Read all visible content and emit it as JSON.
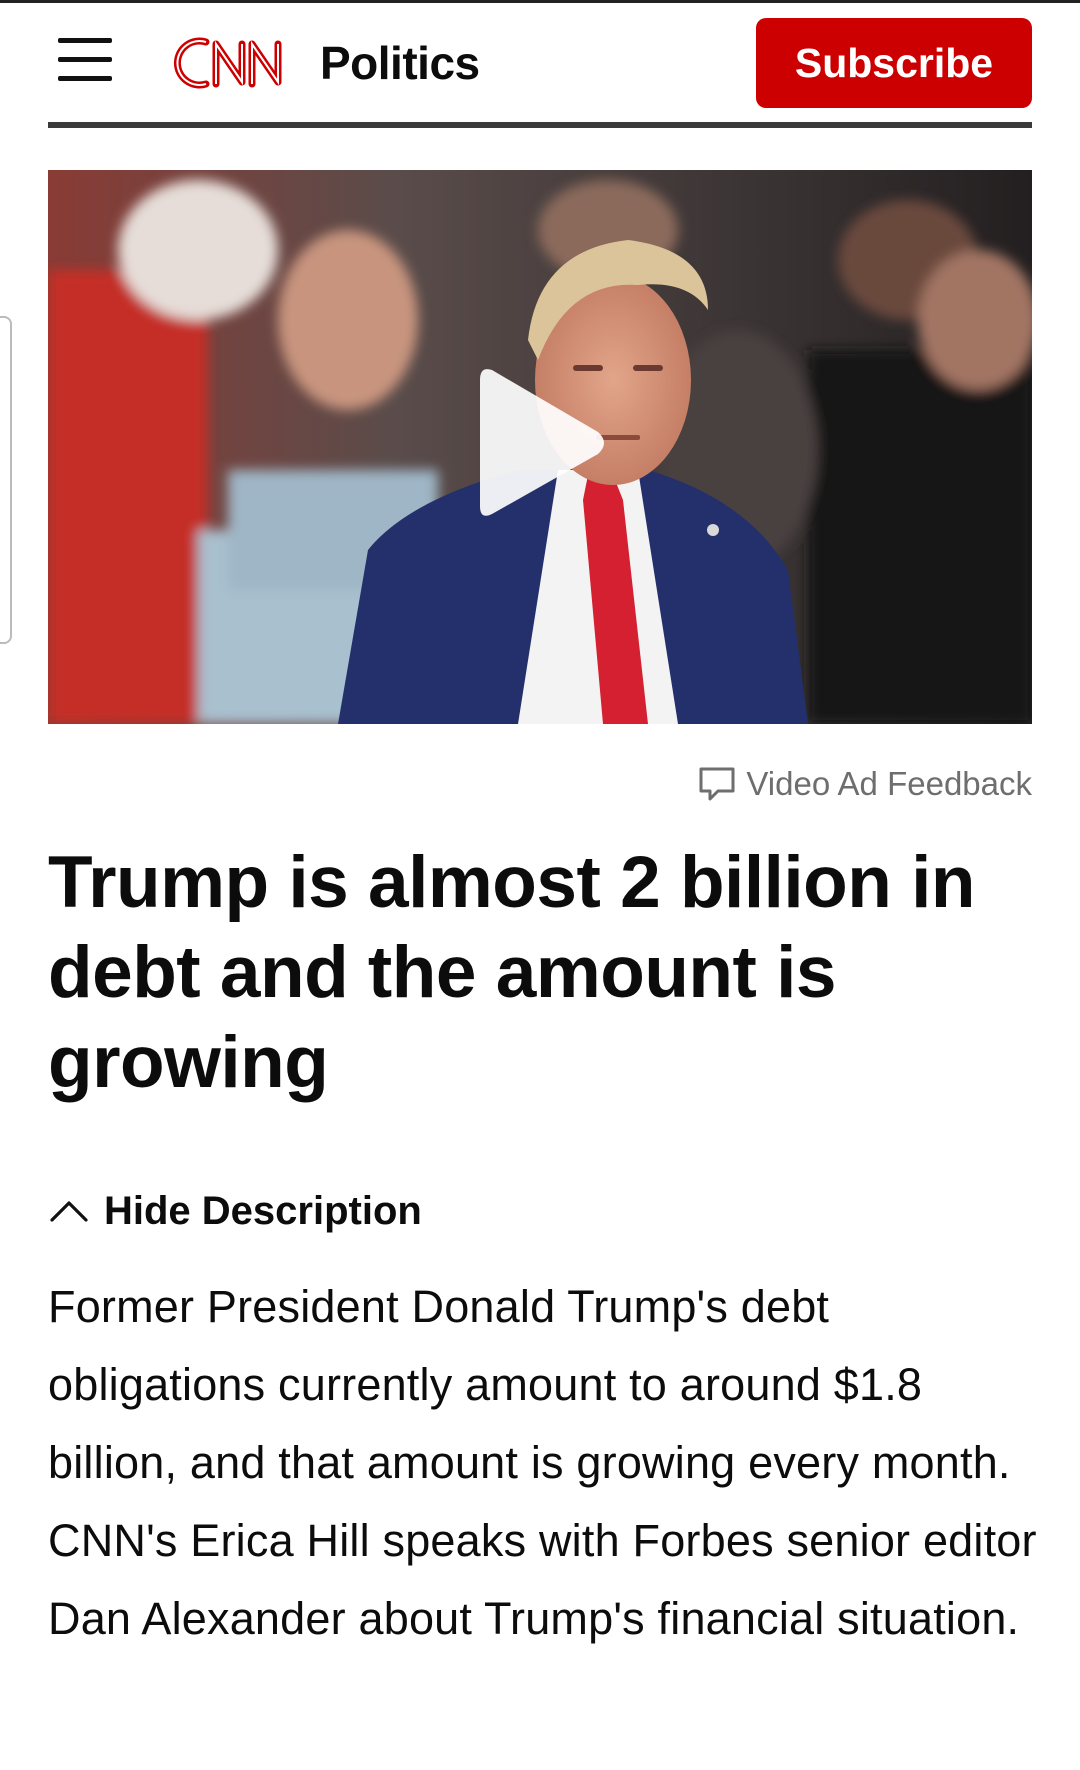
{
  "header": {
    "logo": "CNN",
    "section": "Politics",
    "subscribe_label": "Subscribe",
    "menu_icon": "hamburger-menu-icon"
  },
  "video": {
    "play_icon": "play-icon",
    "ad_feedback_label": "Video Ad Feedback",
    "ad_feedback_icon": "speech-bubble-icon"
  },
  "article": {
    "headline": "Trump is almost 2 billion in debt and the amount is growing",
    "toggle_label": "Hide Description",
    "toggle_icon": "chevron-up-icon",
    "description": "Former President Donald Trump's debt obligations currently amount to around $1.8 billion, and that amount is growing every month. CNN's Erica Hill speaks with Forbes senior editor Dan Alexander about Trump's financial situation."
  },
  "colors": {
    "brand_red": "#cc0000",
    "text": "#0c0c0c",
    "muted": "#6e6e6e"
  }
}
